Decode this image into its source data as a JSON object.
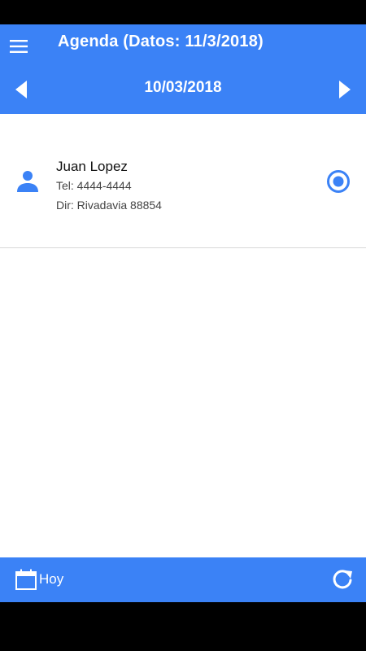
{
  "app_bar": {
    "title": "Agenda (Datos: 11/3/2018)",
    "menu_icon": "menu-icon",
    "current_date": "10/03/2018",
    "prev_icon": "chevron-left-icon",
    "next_icon": "chevron-right-icon"
  },
  "contacts": [
    {
      "name": "Juan Lopez",
      "phone": "Tel: 4444-4444",
      "address": "Dir: Rivadavia 88854",
      "icon": "person-icon",
      "selected": true
    }
  ],
  "bottom_bar": {
    "today_label": "Hoy",
    "today_icon": "calendar-icon",
    "refresh_icon": "refresh-icon"
  },
  "colors": {
    "primary": "#3b82f6",
    "text": "#111111",
    "secondary_text": "#444444",
    "divider": "#d9d9d9"
  }
}
